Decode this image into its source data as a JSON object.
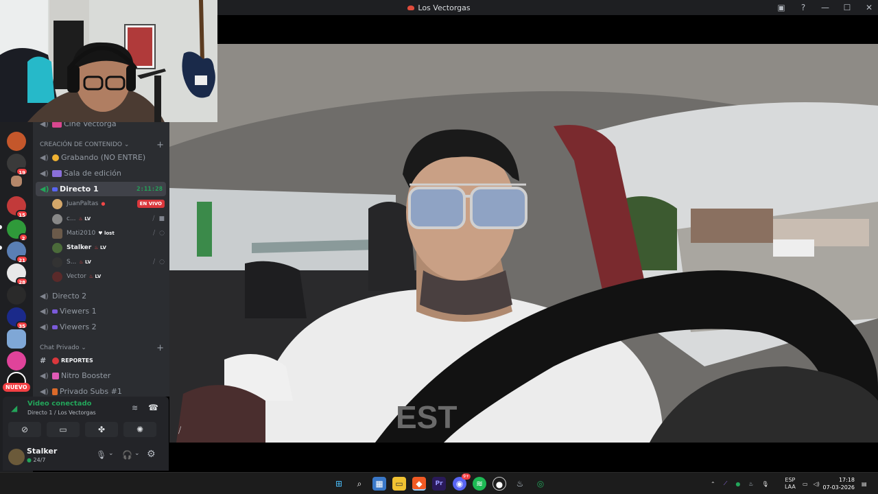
{
  "window": {
    "title": "Los Vectorgas",
    "help_glyph": "?",
    "min_glyph": "—",
    "max_glyph": "☐",
    "close_glyph": "✕"
  },
  "servers": {
    "badges": [
      "19",
      "15",
      "2",
      "21",
      "28",
      "35"
    ],
    "nuevo_label": "NUEVO",
    "accent": "#f23f43"
  },
  "channels": {
    "top_partial": "Cine Vectorga",
    "category1": "CREACIÓN DE CONTENIDO",
    "grabando": "Grabando (NO ENTRE)",
    "sala": "Sala de edición",
    "directo1": "Directo 1",
    "timer": "2:11:28",
    "users": [
      {
        "name": "JuanPaltas",
        "tag": "",
        "live": "EN VIVO"
      },
      {
        "name": "c...",
        "tag": "LV"
      },
      {
        "name": "Mati2010",
        "tag": "lost"
      },
      {
        "name": "Stalker",
        "tag": "LV"
      },
      {
        "name": "S...",
        "tag": "LV"
      },
      {
        "name": "Vector",
        "tag": "LV"
      }
    ],
    "directo2": "Directo 2",
    "viewers1": "Viewers 1",
    "viewers2": "Viewers 2",
    "category2": "Chat Privado",
    "reportes": "REPORTES",
    "nitro": "Nitro Booster",
    "subs": "Privado Subs #1"
  },
  "voice": {
    "status": "Video conectado",
    "location": "Directo 1 / Los Vectorgas"
  },
  "user": {
    "name": "Stalker",
    "status": "24/7"
  },
  "taskbar": {
    "lang_top": "ESP",
    "lang_bottom": "LAA",
    "time": "17:18",
    "date": "07-03-2026",
    "discord_badge": "9+"
  }
}
